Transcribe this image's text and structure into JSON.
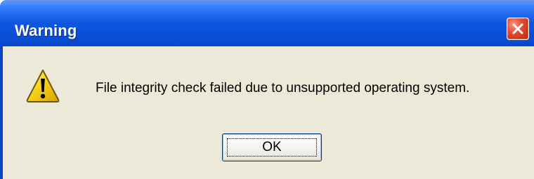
{
  "window": {
    "title": "Warning"
  },
  "dialog": {
    "icon": "warning-icon",
    "message": "File integrity check failed due to unsupported operating system.",
    "ok_label": "OK"
  },
  "colors": {
    "titlebar": "#0b4fd8",
    "body": "#ece9d8",
    "close_button": "#cf3a1e",
    "warning_yellow": "#f7d21a"
  }
}
